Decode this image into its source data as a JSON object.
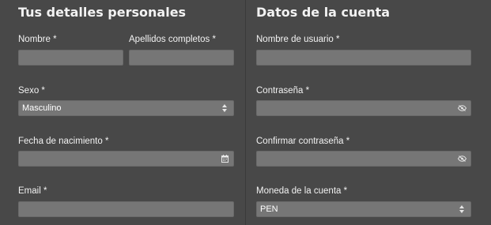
{
  "personal": {
    "heading": "Tus detalles personales",
    "name_label": "Nombre *",
    "surname_label": "Apellidos completos *",
    "sex_label": "Sexo *",
    "sex_value": "Masculino",
    "birthdate_label": "Fecha de nacimiento *",
    "email_label": "Email *"
  },
  "account": {
    "heading": "Datos de la cuenta",
    "username_label": "Nombre de usuario *",
    "password_label": "Contraseña *",
    "confirm_password_label": "Confirmar contraseña *",
    "currency_label": "Moneda de la cuenta *",
    "currency_value": "PEN"
  },
  "icons": {
    "select": "sort-arrows-icon",
    "date": "calendar-icon",
    "password": "eye-slash-icon"
  },
  "colors": {
    "background": "#484848",
    "field": "#767676",
    "text": "#f2f2f2"
  }
}
